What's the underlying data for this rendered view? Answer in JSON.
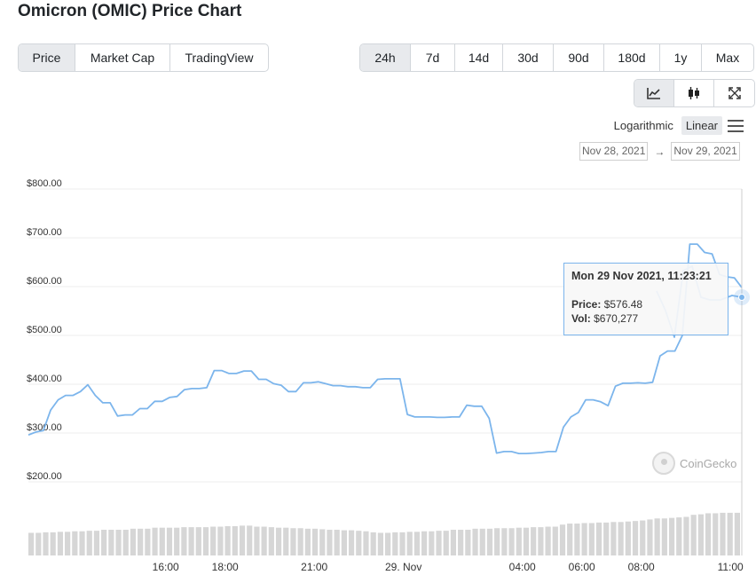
{
  "page": {
    "title": "Omicron (OMIC) Price Chart"
  },
  "view_tabs": [
    {
      "label": "Price",
      "active": true
    },
    {
      "label": "Market Cap",
      "active": false
    },
    {
      "label": "TradingView",
      "active": false
    }
  ],
  "range_tabs": [
    {
      "label": "24h",
      "active": true
    },
    {
      "label": "7d",
      "active": false
    },
    {
      "label": "14d",
      "active": false
    },
    {
      "label": "30d",
      "active": false
    },
    {
      "label": "90d",
      "active": false
    },
    {
      "label": "180d",
      "active": false
    },
    {
      "label": "1y",
      "active": false
    },
    {
      "label": "Max",
      "active": false
    }
  ],
  "chart_type_buttons": [
    {
      "icon": "line-chart-icon",
      "active": true
    },
    {
      "icon": "candlestick-icon",
      "active": false
    },
    {
      "icon": "fullscreen-icon",
      "active": false
    }
  ],
  "scale": {
    "log_label": "Logarithmic",
    "linear_label": "Linear",
    "active": "Linear"
  },
  "date_range": {
    "from": "Nov 28, 2021",
    "arrow": "→",
    "to": "Nov 29, 2021"
  },
  "tooltip": {
    "title": "Mon 29 Nov 2021, 11:23:21",
    "price_label": "Price:",
    "price_value": "$576.48",
    "vol_label": "Vol:",
    "vol_value": "$670,277"
  },
  "credit": {
    "label": "CoinGecko"
  },
  "colors": {
    "line": "#7cb5ec",
    "volume": "#d6d6d6",
    "grid": "#ececec",
    "active_bg": "#e8eaed"
  },
  "chart_data": {
    "type": "line",
    "y_ticks": [
      {
        "value": 200,
        "label": "$200.00"
      },
      {
        "value": 300,
        "label": "$300.00"
      },
      {
        "value": 400,
        "label": "$400.00"
      },
      {
        "value": 500,
        "label": "$500.00"
      },
      {
        "value": 600,
        "label": "$600.00"
      },
      {
        "value": 700,
        "label": "$700.00"
      },
      {
        "value": 800,
        "label": "$800.00"
      }
    ],
    "ylim": [
      200,
      800
    ],
    "x_ticks": [
      {
        "hour": 16,
        "label": "16:00"
      },
      {
        "hour": 18,
        "label": "18:00"
      },
      {
        "hour": 21,
        "label": "21:00"
      },
      {
        "hour": 24,
        "label": "29. Nov"
      },
      {
        "hour": 28,
        "label": "04:00"
      },
      {
        "hour": 30,
        "label": "06:00"
      },
      {
        "hour": 32,
        "label": "08:00"
      },
      {
        "hour": 35,
        "label": "11:00"
      }
    ],
    "x_range": [
      "2021-11-28 11:23",
      "2021-11-29 11:23"
    ],
    "series": [
      {
        "points": [
          [
            "2021-11-28 11:23",
            296
          ],
          [
            "2021-11-28 11:38",
            302
          ],
          [
            "2021-11-28 11:53",
            305
          ],
          [
            "2021-11-28 12:08",
            347
          ],
          [
            "2021-11-28 12:23",
            368
          ],
          [
            "2021-11-28 12:38",
            377
          ],
          [
            "2021-11-28 12:53",
            377
          ],
          [
            "2021-11-28 13:08",
            385
          ],
          [
            "2021-11-28 13:23",
            399
          ],
          [
            "2021-11-28 13:38",
            377
          ],
          [
            "2021-11-28 13:53",
            362
          ],
          [
            "2021-11-28 14:08",
            362
          ],
          [
            "2021-11-28 14:23",
            335
          ],
          [
            "2021-11-28 14:38",
            337
          ],
          [
            "2021-11-28 14:53",
            337
          ],
          [
            "2021-11-28 15:08",
            350
          ],
          [
            "2021-11-28 15:23",
            350
          ],
          [
            "2021-11-28 15:38",
            365
          ],
          [
            "2021-11-28 15:53",
            365
          ],
          [
            "2021-11-28 16:08",
            373
          ],
          [
            "2021-11-28 16:23",
            375
          ],
          [
            "2021-11-28 16:38",
            389
          ],
          [
            "2021-11-28 16:53",
            391
          ],
          [
            "2021-11-28 17:08",
            391
          ],
          [
            "2021-11-28 17:23",
            393
          ],
          [
            "2021-11-28 17:38",
            428
          ],
          [
            "2021-11-28 17:53",
            428
          ],
          [
            "2021-11-28 18:08",
            422
          ],
          [
            "2021-11-28 18:23",
            422
          ],
          [
            "2021-11-28 18:38",
            427
          ],
          [
            "2021-11-28 18:53",
            427
          ],
          [
            "2021-11-28 19:08",
            410
          ],
          [
            "2021-11-28 19:23",
            410
          ],
          [
            "2021-11-28 19:38",
            401
          ],
          [
            "2021-11-28 19:53",
            398
          ],
          [
            "2021-11-28 20:08",
            385
          ],
          [
            "2021-11-28 20:23",
            385
          ],
          [
            "2021-11-28 20:38",
            403
          ],
          [
            "2021-11-28 20:53",
            403
          ],
          [
            "2021-11-28 21:08",
            405
          ],
          [
            "2021-11-28 21:23",
            401
          ],
          [
            "2021-11-28 21:38",
            397
          ],
          [
            "2021-11-28 21:53",
            397
          ],
          [
            "2021-11-28 22:08",
            395
          ],
          [
            "2021-11-28 22:23",
            395
          ],
          [
            "2021-11-28 22:38",
            393
          ],
          [
            "2021-11-28 22:53",
            393
          ],
          [
            "2021-11-28 23:08",
            410
          ],
          [
            "2021-11-28 23:23",
            411
          ],
          [
            "2021-11-28 23:38",
            411
          ],
          [
            "2021-11-28 23:53",
            411
          ],
          [
            "2021-11-29 00:08",
            338
          ],
          [
            "2021-11-29 00:23",
            333
          ],
          [
            "2021-11-29 00:38",
            333
          ],
          [
            "2021-11-29 00:53",
            333
          ],
          [
            "2021-11-29 01:08",
            332
          ],
          [
            "2021-11-29 01:23",
            332
          ],
          [
            "2021-11-29 01:38",
            333
          ],
          [
            "2021-11-29 01:53",
            333
          ],
          [
            "2021-11-29 02:08",
            357
          ],
          [
            "2021-11-29 02:23",
            355
          ],
          [
            "2021-11-29 02:38",
            355
          ],
          [
            "2021-11-29 02:53",
            330
          ],
          [
            "2021-11-29 03:08",
            259
          ],
          [
            "2021-11-29 03:23",
            262
          ],
          [
            "2021-11-29 03:38",
            262
          ],
          [
            "2021-11-29 03:53",
            258
          ],
          [
            "2021-11-29 04:08",
            258
          ],
          [
            "2021-11-29 04:23",
            259
          ],
          [
            "2021-11-29 04:38",
            260
          ],
          [
            "2021-11-29 04:53",
            262
          ],
          [
            "2021-11-29 05:08",
            262
          ],
          [
            "2021-11-29 05:23",
            312
          ],
          [
            "2021-11-29 05:38",
            333
          ],
          [
            "2021-11-29 05:53",
            342
          ],
          [
            "2021-11-29 06:08",
            368
          ],
          [
            "2021-11-29 06:23",
            368
          ],
          [
            "2021-11-29 06:38",
            364
          ],
          [
            "2021-11-29 06:53",
            356
          ],
          [
            "2021-11-29 07:08",
            396
          ],
          [
            "2021-11-29 07:23",
            402
          ],
          [
            "2021-11-29 07:38",
            402
          ],
          [
            "2021-11-29 07:53",
            403
          ],
          [
            "2021-11-29 08:08",
            402
          ],
          [
            "2021-11-29 08:23",
            404
          ],
          [
            "2021-11-29 08:38",
            458
          ],
          [
            "2021-11-29 08:53",
            468
          ],
          [
            "2021-11-29 09:08",
            468
          ],
          [
            "2021-11-29 09:23",
            500
          ],
          [
            "2021-11-29 09:38",
            687
          ],
          [
            "2021-11-29 09:53",
            687
          ],
          [
            "2021-11-29 10:08",
            670
          ],
          [
            "2021-11-29 10:23",
            667
          ],
          [
            "2021-11-29 10:38",
            625
          ],
          [
            "2021-11-29 10:53",
            620
          ],
          [
            "2021-11-29 11:08",
            618
          ],
          [
            "2021-11-29 11:23",
            598
          ]
        ]
      }
    ],
    "note_x_mapping": "x axis spans 24 hours; tick labels are hours of the 24h window",
    "volume_relative": [
      0.44,
      0.44,
      0.45,
      0.45,
      0.46,
      0.46,
      0.47,
      0.47,
      0.48,
      0.48,
      0.5,
      0.5,
      0.5,
      0.5,
      0.52,
      0.52,
      0.52,
      0.54,
      0.54,
      0.54,
      0.54,
      0.55,
      0.55,
      0.55,
      0.55,
      0.56,
      0.56,
      0.57,
      0.57,
      0.58,
      0.58,
      0.56,
      0.56,
      0.55,
      0.54,
      0.54,
      0.53,
      0.53,
      0.52,
      0.52,
      0.51,
      0.5,
      0.5,
      0.49,
      0.49,
      0.48,
      0.47,
      0.45,
      0.44,
      0.44,
      0.45,
      0.45,
      0.46,
      0.46,
      0.47,
      0.47,
      0.48,
      0.48,
      0.5,
      0.5,
      0.5,
      0.52,
      0.52,
      0.52,
      0.53,
      0.53,
      0.53,
      0.54,
      0.54,
      0.55,
      0.55,
      0.56,
      0.56,
      0.6,
      0.62,
      0.62,
      0.63,
      0.63,
      0.64,
      0.64,
      0.65,
      0.65,
      0.66,
      0.67,
      0.68,
      0.7,
      0.72,
      0.72,
      0.73,
      0.74,
      0.75,
      0.79,
      0.8,
      0.82,
      0.82,
      0.83,
      0.83,
      0.83
    ]
  }
}
